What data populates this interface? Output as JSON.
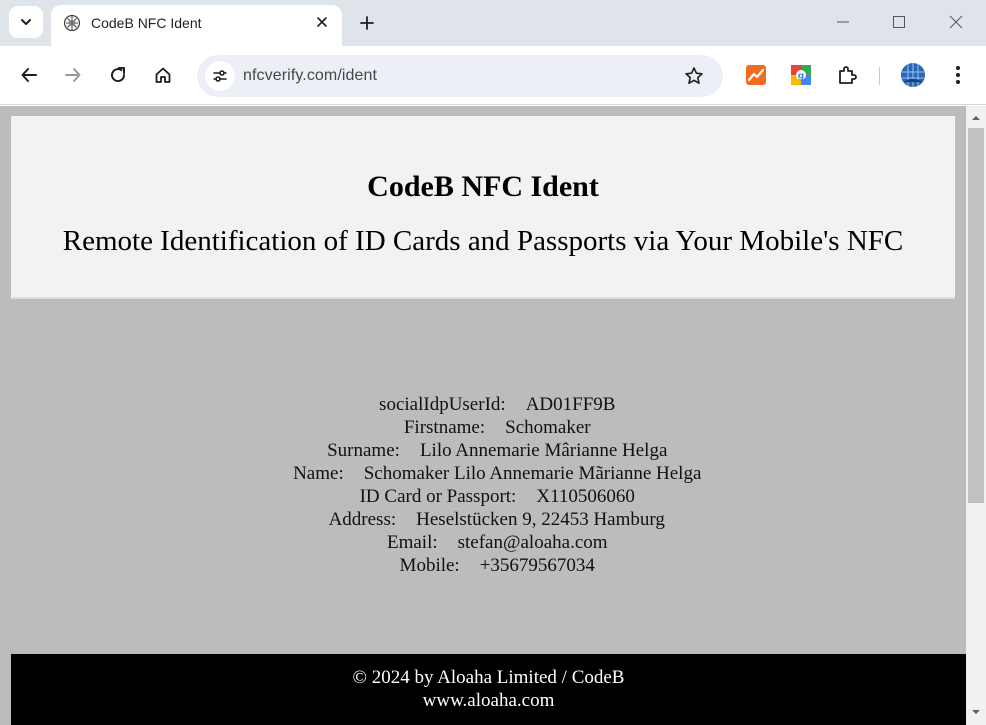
{
  "browser": {
    "tab_title": "CodeB NFC Ident",
    "url": "nfcverify.com/ident",
    "icons": [
      "tab-search-icon",
      "favicon-icon",
      "close-icon",
      "plus-icon",
      "minimize-icon",
      "maximize-icon",
      "window-close-icon",
      "back-icon",
      "forward-icon",
      "reload-icon",
      "home-icon",
      "site-info-icon",
      "star-icon",
      "analytics-extension-icon",
      "google-extension-icon",
      "extensions-puzzle-icon",
      "profile-icon",
      "more-menu-icon"
    ]
  },
  "page": {
    "title": "CodeB NFC Ident",
    "subtitle": "Remote Identification of ID Cards and Passports via Your Mobile's NFC",
    "fields": [
      {
        "label": "socialIdpUserId:",
        "value": "AD01FF9B"
      },
      {
        "label": "Firstname:",
        "value": "Schomaker"
      },
      {
        "label": "Surname:",
        "value": "Lilo Annemarie Mârianne Helga"
      },
      {
        "label": "Name:",
        "value": "Schomaker Lilo Annemarie Mãrianne Helga"
      },
      {
        "label": "ID Card or Passport:",
        "value": "X110506060"
      },
      {
        "label": "Address:",
        "value": "Heselstücken 9, 22453 Hamburg"
      },
      {
        "label": "Email:",
        "value": "stefan@aloaha.com"
      },
      {
        "label": "Mobile:",
        "value": "+35679567034"
      }
    ],
    "footer": {
      "line1": "© 2024 by Aloaha Limited / CodeB",
      "line2": "www.aloaha.com"
    }
  },
  "colors": {
    "page_background": "#bcbcbc",
    "header_background": "#f2f2f2",
    "footer_background": "#000000",
    "tabstrip": "#dfe3ea",
    "omnibox": "#eceff6"
  }
}
